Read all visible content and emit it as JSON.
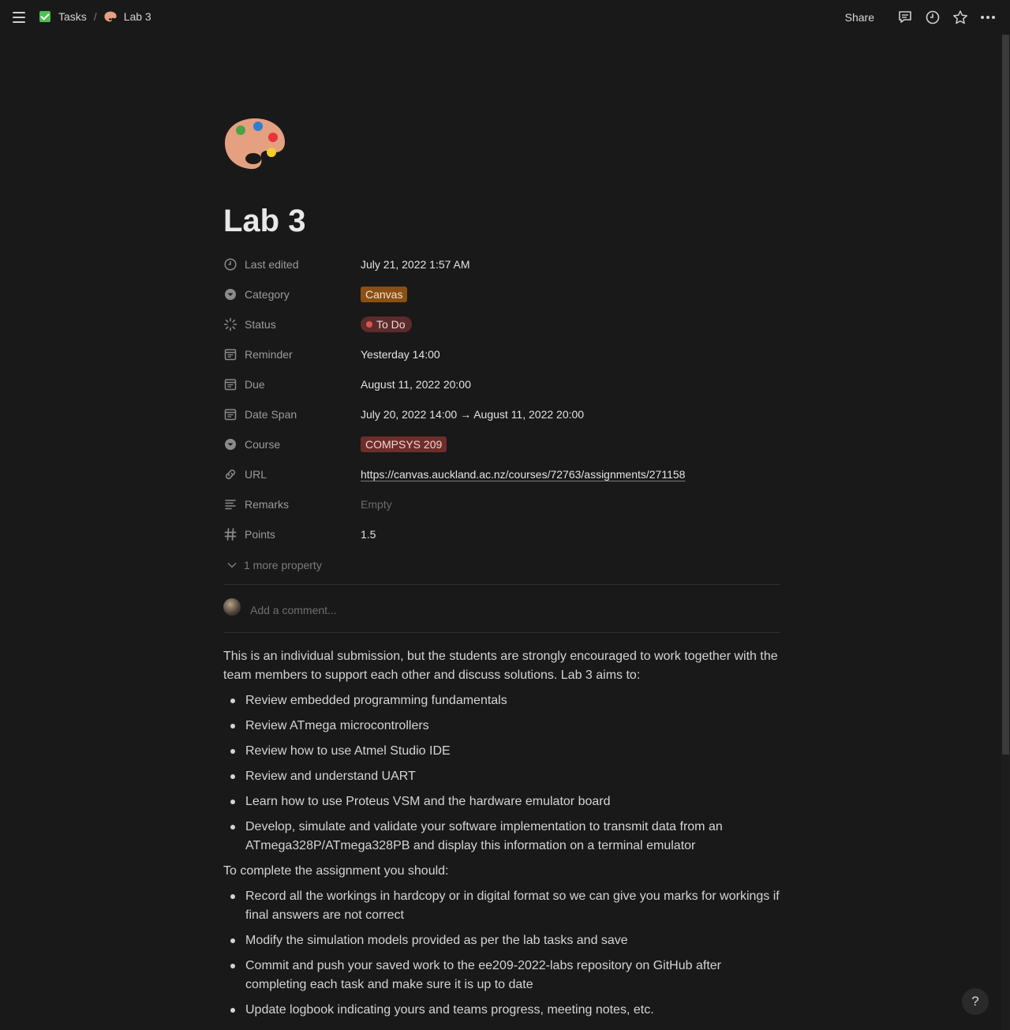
{
  "topbar": {
    "breadcrumb": [
      {
        "label": "Tasks",
        "icon": "checkbox-icon"
      },
      {
        "label": "Lab 3",
        "icon": "palette-icon"
      }
    ],
    "separator": "/",
    "share_label": "Share",
    "icons": [
      "comment-icon",
      "clock-icon",
      "star-icon",
      "more-icon"
    ]
  },
  "page": {
    "icon": "palette-icon",
    "title": "Lab 3"
  },
  "properties": [
    {
      "label": "Last edited",
      "value": "July 21, 2022 1:57 AM",
      "icon": "clock-icon"
    },
    {
      "label": "Category",
      "value": "Canvas",
      "icon": "select-icon",
      "tag_color": "#8a4f14"
    },
    {
      "label": "Status",
      "value": "To Do",
      "icon": "status-icon",
      "tag_color": "#5c2b2b"
    },
    {
      "label": "Reminder",
      "value": "Yesterday 14:00",
      "icon": "calendar-icon"
    },
    {
      "label": "Due",
      "value": "August 11, 2022 20:00",
      "icon": "calendar-icon"
    },
    {
      "label": "Date Span",
      "value": "July 20, 2022 14:00 → August 11, 2022 20:00",
      "icon": "calendar-icon"
    },
    {
      "label": "Course",
      "value": "COMPSYS 209",
      "icon": "select-icon",
      "tag_color": "#6f2d2a"
    },
    {
      "label": "URL",
      "value": "https://canvas.auckland.ac.nz/courses/72763/assignments/271158",
      "icon": "link-icon"
    },
    {
      "label": "Remarks",
      "value": "Empty",
      "icon": "text-icon"
    },
    {
      "label": "Points",
      "value": "1.5",
      "icon": "hash-icon"
    }
  ],
  "more_property": "1 more property",
  "comment_placeholder": "Add a comment...",
  "content": {
    "intro": "This is an individual submission, but the students are strongly encouraged to work together with the team members to support each other and discuss solutions. Lab 3 aims to:",
    "aims": [
      "Review embedded programming fundamentals",
      "Review ATmega microcontrollers",
      "Review how to use Atmel Studio IDE",
      "Review and understand UART",
      "Learn how to use Proteus VSM and the hardware emulator board",
      "Develop, simulate and validate your software implementation to transmit data from an ATmega328P/ATmega328PB and display this information on a terminal emulator"
    ],
    "complete_heading": "To complete the assignment you should:",
    "steps": [
      "Record all the workings in hardcopy or in digital format so we can give you marks for workings if final answers are not correct",
      "Modify the simulation models provided as per the lab tasks and save",
      "Commit and push your saved work to the ee209-2022-labs repository on GitHub after completing each task and make sure it is up to date",
      "Update logbook indicating yours and teams progress, meeting notes, etc."
    ]
  },
  "help_label": "?"
}
